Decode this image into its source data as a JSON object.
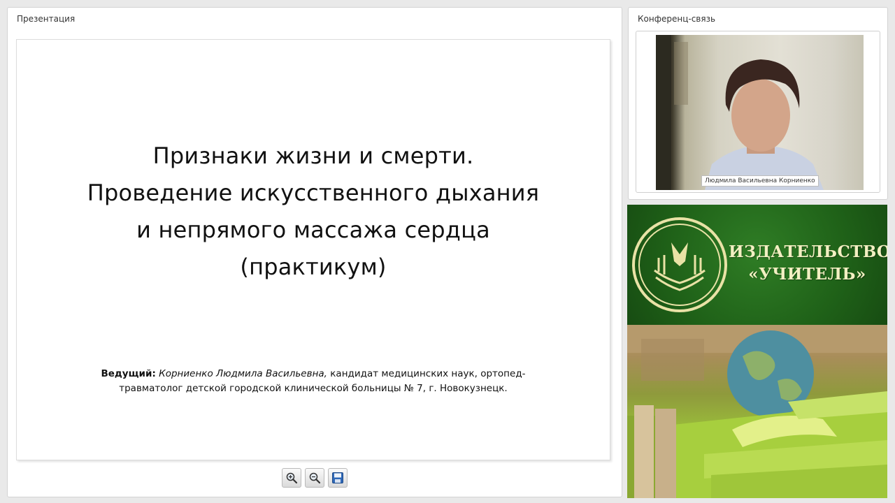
{
  "presentation": {
    "title": "Презентация",
    "slide": {
      "title_lines": [
        "Признаки жизни и смерти.",
        "Проведение искусственного дыхания",
        "и непрямого массажа сердца",
        "(практикум)"
      ],
      "presenter_label": "Ведущий:",
      "presenter_name": "Корниенко Людмила Васильевна,",
      "presenter_desc_1": "кандидат медицинских наук, ортопед-",
      "presenter_desc_2": "травматолог детской городской клинической больницы № 7, г. Новокузнецк."
    },
    "toolbar": [
      {
        "name": "zoom-in",
        "icon": "zoom-in-icon"
      },
      {
        "name": "zoom-out",
        "icon": "zoom-out-icon"
      },
      {
        "name": "save",
        "icon": "save-icon"
      }
    ]
  },
  "conference": {
    "title": "Конференц-связь",
    "participant_name": "Людмила Васильевна Корниенко"
  },
  "banner": {
    "publisher_line1": "ИЗДАТЕЛЬСТВО",
    "publisher_line2": "«УЧИТЕЛЬ»",
    "colors": {
      "green": "#1f6118",
      "gold": "#f3f0c2"
    }
  }
}
